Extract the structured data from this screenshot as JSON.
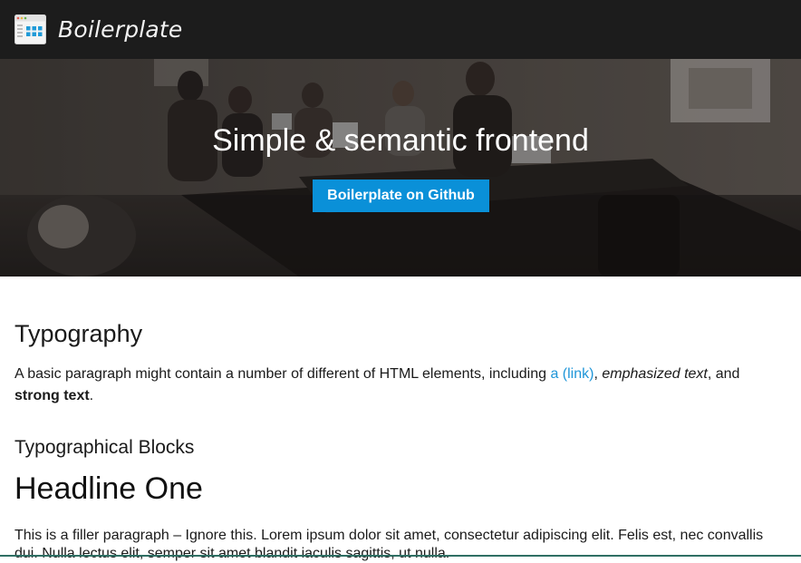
{
  "nav": {
    "brand": "Boilerplate",
    "logo_icon": "browser-window-icon"
  },
  "hero": {
    "title": "Simple & semantic frontend",
    "cta_label": "Boilerplate on Github",
    "cta_color": "#0a90d8",
    "background": "office-meeting-photo"
  },
  "content": {
    "heading": "Typography",
    "paragraph": {
      "text_before": "A basic paragraph might contain a number of different of HTML elements, including ",
      "link_text": "a (link)",
      "sep": ", ",
      "emphasized": "emphasized text",
      "text_mid": ", and ",
      "strong": "strong text",
      "text_end": "."
    },
    "subheading": "Typographical Blocks",
    "headline": "Headline One",
    "filler": "This is a filler paragraph – Ignore this. Lorem ipsum dolor sit amet, consectetur adipiscing elit. Felis est, nec convallis dui. Nulla lectus elit, semper sit amet blandit iaculis sagittis, ut nulla."
  },
  "colors": {
    "topbar": "#1c1c1c",
    "link": "#1f96d8"
  }
}
